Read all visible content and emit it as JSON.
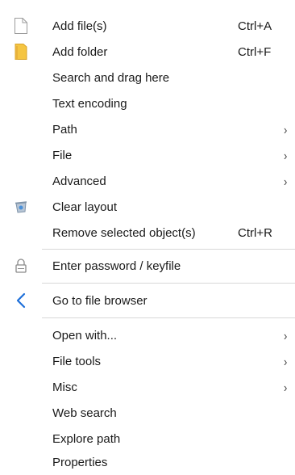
{
  "menu": {
    "items": [
      {
        "label": "Add file(s)",
        "shortcut": "Ctrl+A",
        "icon": "blank-file-icon"
      },
      {
        "label": "Add folder",
        "shortcut": "Ctrl+F",
        "icon": "yellow-folder-icon"
      },
      {
        "label": "Search and drag here"
      },
      {
        "label": "Text encoding"
      },
      {
        "label": "Path",
        "submenu": "›"
      },
      {
        "label": "File",
        "submenu": "›"
      },
      {
        "label": "Advanced",
        "submenu": "›"
      },
      {
        "label": "Clear layout",
        "icon": "recycle-bin-icon"
      },
      {
        "label": "Remove selected object(s)",
        "shortcut": "Ctrl+R"
      },
      {
        "label": "Enter password / keyfile",
        "icon": "padlock-icon"
      },
      {
        "label": "Go to file browser",
        "icon": "back-chevron-icon"
      },
      {
        "label": "Open with...",
        "submenu": "›"
      },
      {
        "label": "File tools",
        "submenu": "›"
      },
      {
        "label": "Misc",
        "submenu": "›"
      },
      {
        "label": "Web search"
      },
      {
        "label": "Explore path"
      },
      {
        "label": "Properties"
      }
    ]
  },
  "colors": {
    "accent": "#1e6fd9",
    "folder": "#f5c542",
    "separator": "#d8d8d8"
  }
}
